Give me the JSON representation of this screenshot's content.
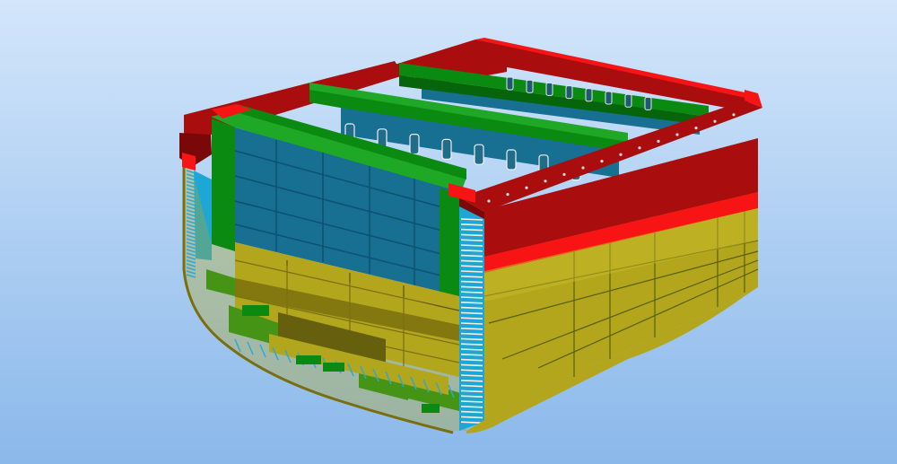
{
  "scene": {
    "subject": "ship-hull-block-3d-model",
    "background": {
      "top": "#d3e6fb",
      "bottom": "#8ab8ea"
    },
    "colors": {
      "deck_red": "#a90d0d",
      "bright_red": "#f81414",
      "dark_red": "#7a0808",
      "girder_green": "#0b8a11",
      "light_green": "#1fa826",
      "dark_green": "#06650b",
      "tank_blue": "#176f91",
      "sky_blue": "#1ea6d6",
      "hull_olive": "#b3a61c",
      "hull_light": "#c8ba27",
      "hull_dark": "#6b6008",
      "bottom_dark": "#3d3a07",
      "frame_line": "#374616"
    }
  }
}
